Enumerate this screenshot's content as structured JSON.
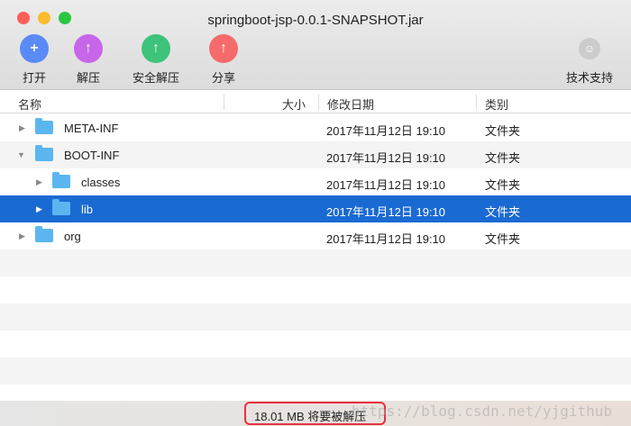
{
  "window": {
    "title": "springboot-jsp-0.0.1-SNAPSHOT.jar"
  },
  "toolbar": {
    "open": "打开",
    "extract": "解压",
    "safe_extract": "安全解压",
    "share": "分享",
    "support": "技术支持"
  },
  "columns": {
    "name": "名称",
    "size": "大小",
    "date": "修改日期",
    "kind": "类别"
  },
  "rows": [
    {
      "name": "META-INF",
      "date": "2017年11月12日 19:10",
      "kind": "文件夹"
    },
    {
      "name": "BOOT-INF",
      "date": "2017年11月12日 19:10",
      "kind": "文件夹"
    },
    {
      "name": "classes",
      "date": "2017年11月12日 19:10",
      "kind": "文件夹"
    },
    {
      "name": "lib",
      "date": "2017年11月12日 19:10",
      "kind": "文件夹"
    },
    {
      "name": "org",
      "date": "2017年11月12日 19:10",
      "kind": "文件夹"
    }
  ],
  "status": "18.01 MB 将要被解压",
  "watermark": "https://blog.csdn.net/yjgithub",
  "colors": {
    "selection": "#1a6ad3",
    "highlight_box": "#e8303f"
  }
}
